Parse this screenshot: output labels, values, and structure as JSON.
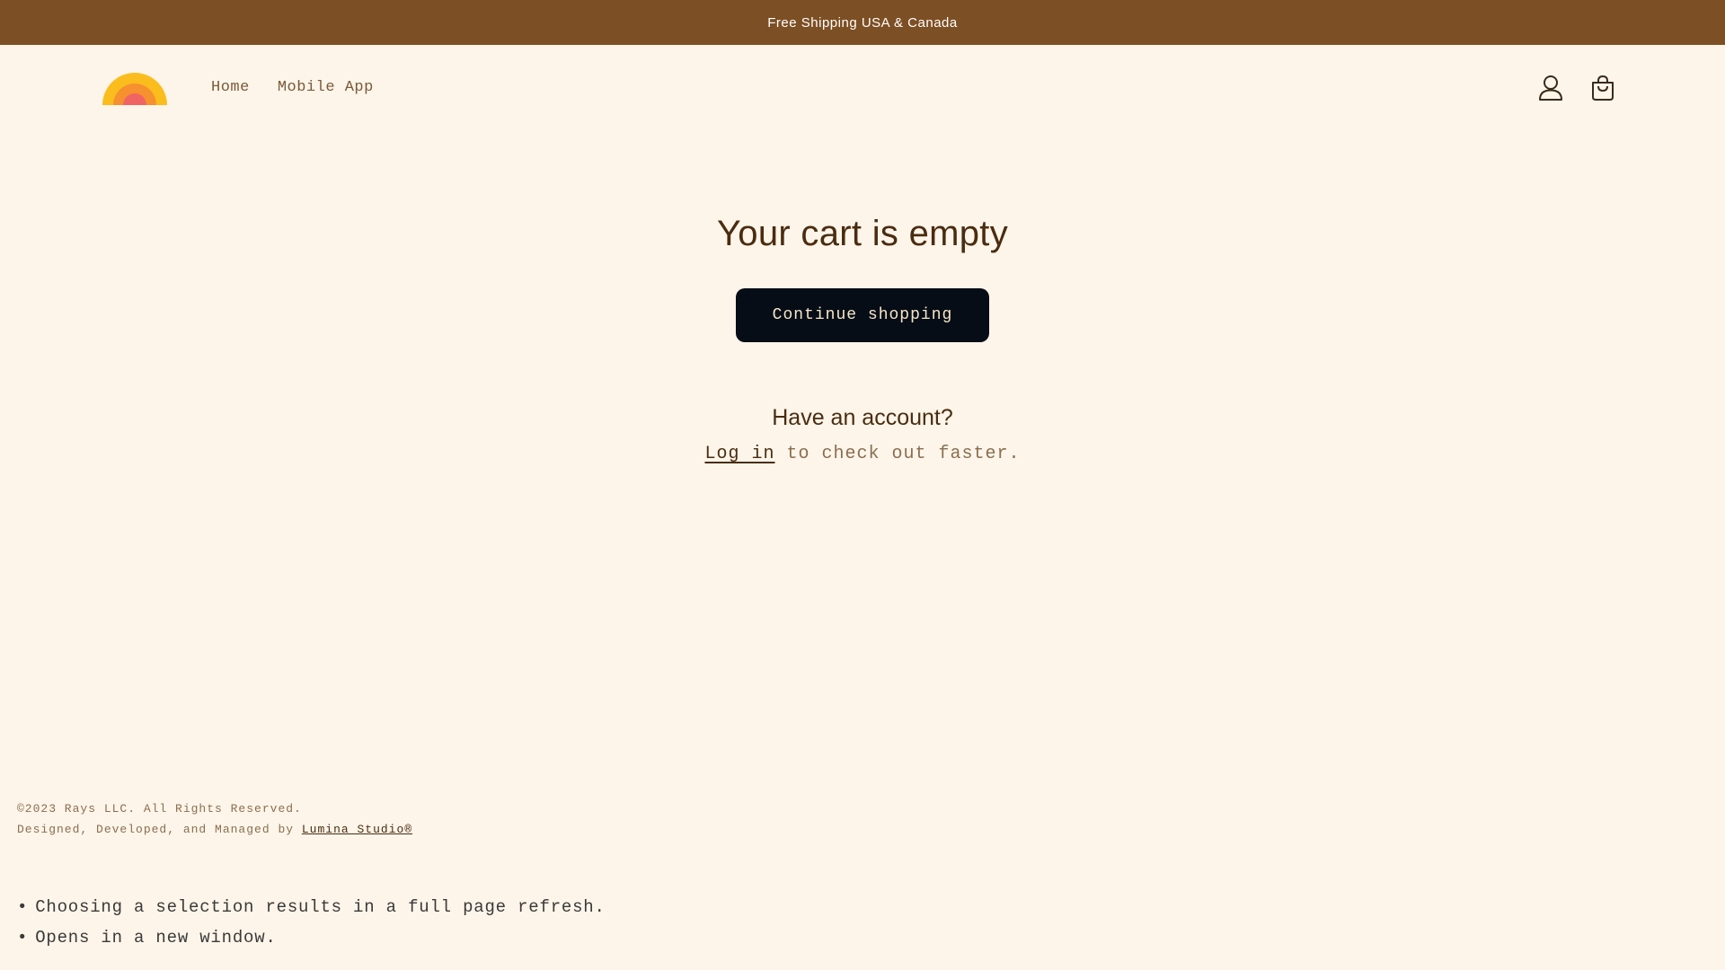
{
  "announcement": {
    "text": "Free Shipping USA & Canada"
  },
  "header": {
    "logo_colors": [
      "#fbbd1e",
      "#f7902e",
      "#f06464"
    ],
    "nav": [
      {
        "label": "Home"
      },
      {
        "label": "Mobile App"
      }
    ],
    "icons": {
      "account": "account-icon",
      "cart": "cart-icon"
    }
  },
  "main": {
    "title": "Your cart is empty",
    "continue_label": "Continue shopping",
    "account_heading": "Have an account?",
    "login_link": "Log in",
    "login_suffix": " to check out faster."
  },
  "footer": {
    "copyright": "©2023 Rays LLC. All Rights Reserved.",
    "credit_prefix": "Designed, Developed, and Managed by ",
    "credit_link": "Lumina Studio®"
  },
  "notes": [
    "Choosing a selection results in a full page refresh.",
    "Opens in a new window."
  ],
  "colors": {
    "background": "#fdf5e9",
    "announcement_bar": "#7d4f24",
    "button": "#060d17",
    "heading": "#4a2c10"
  }
}
